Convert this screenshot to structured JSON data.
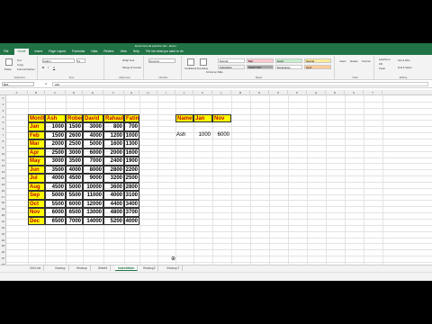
{
  "titlebar": {
    "title": "Excel formula practice.xlsx - Excel"
  },
  "tabs": [
    "File",
    "Home",
    "Insert",
    "Page Layout",
    "Formulas",
    "Data",
    "Review",
    "View",
    "Help",
    "Tell me what you want to do"
  ],
  "ribbon": {
    "clipboard": {
      "label": "Clipboard",
      "paste": "Paste",
      "cut": "Cut",
      "copy": "Copy",
      "painter": "Format Painter"
    },
    "font": {
      "label": "Font",
      "name": "Calibri",
      "size": "11"
    },
    "alignment": {
      "label": "Alignment",
      "wrap": "Wrap Text",
      "merge": "Merge & Center"
    },
    "number": {
      "label": "Number",
      "format": "General"
    },
    "styles": {
      "label": "Styles",
      "cond": "Conditional Formatting",
      "table": "Format as Table",
      "cells": [
        {
          "t": "Normal",
          "bg": "#ffffff"
        },
        {
          "t": "Bad",
          "bg": "#ffc7ce"
        },
        {
          "t": "Good",
          "bg": "#c6efce"
        },
        {
          "t": "Neutral",
          "bg": "#ffeb9c"
        },
        {
          "t": "Calculation",
          "bg": "#f2f2f2"
        },
        {
          "t": "Check Cell",
          "bg": "#a5a5a5"
        },
        {
          "t": "Explanatory",
          "bg": "#ffffff"
        },
        {
          "t": "Input",
          "bg": "#ffcc99"
        }
      ]
    },
    "cells": {
      "label": "Cells",
      "insert": "Insert",
      "delete": "Delete",
      "format": "Format"
    },
    "editing": {
      "label": "Editing",
      "autosum": "AutoSum",
      "fill": "Fill",
      "clear": "Clear",
      "sort": "Sort & Filter",
      "find": "Find & Select"
    }
  },
  "formula": {
    "namebox": "B16",
    "fx": "fx",
    "value": "Ash"
  },
  "columns": [
    "A",
    "B",
    "C",
    "D",
    "E",
    "F",
    "G",
    "H",
    "I",
    "J",
    "K",
    "L",
    "M",
    "N",
    "O",
    "P",
    "Q",
    "R",
    "S",
    "T"
  ],
  "rows": [
    "1",
    "2",
    "3",
    "4",
    "5",
    "6",
    "7",
    "8",
    "9",
    "10",
    "11",
    "12",
    "13",
    "14",
    "15",
    "16",
    "17",
    "18",
    "19",
    "20",
    "21",
    "22",
    "23",
    "24",
    "25",
    "26",
    "27",
    "28",
    "29",
    "30",
    "31",
    "32",
    "33",
    "34"
  ],
  "table": {
    "headers": [
      "Months",
      "Ash",
      "Robert",
      "David",
      "Rahaul",
      "Fatima"
    ],
    "rows": [
      [
        "Jan",
        "1000",
        "1500",
        "3000",
        "800",
        "700"
      ],
      [
        "Feb",
        "1500",
        "2600",
        "4000",
        "1200",
        "1000"
      ],
      [
        "Mar",
        "2000",
        "2500",
        "5000",
        "1600",
        "1300"
      ],
      [
        "Apr",
        "2500",
        "3000",
        "6000",
        "2000",
        "1600"
      ],
      [
        "May",
        "3000",
        "3500",
        "7000",
        "2400",
        "1900"
      ],
      [
        "Jun",
        "3500",
        "4000",
        "8000",
        "2800",
        "2200"
      ],
      [
        "Jul",
        "4000",
        "4500",
        "9000",
        "3200",
        "2500"
      ],
      [
        "Aug",
        "4500",
        "5000",
        "10000",
        "3600",
        "2800"
      ],
      [
        "Sep",
        "5000",
        "5500",
        "11000",
        "4000",
        "3100"
      ],
      [
        "Oct",
        "5500",
        "6000",
        "12000",
        "4400",
        "3400"
      ],
      [
        "Nov",
        "6000",
        "6500",
        "13000",
        "4800",
        "3700"
      ],
      [
        "Dec",
        "6500",
        "7000",
        "14000",
        "5200",
        "4000"
      ]
    ]
  },
  "lookup": {
    "headers": [
      "Names",
      "Jan",
      "Nov"
    ],
    "result": [
      "Ash",
      "1000",
      "6000"
    ]
  },
  "sheets": [
    "Cell Link",
    "Vlookup",
    "Hlookup",
    "Sheet4",
    "Index/Match",
    "Hlookup2",
    "Vlookup 2"
  ],
  "active_sheet": "Index/Match"
}
